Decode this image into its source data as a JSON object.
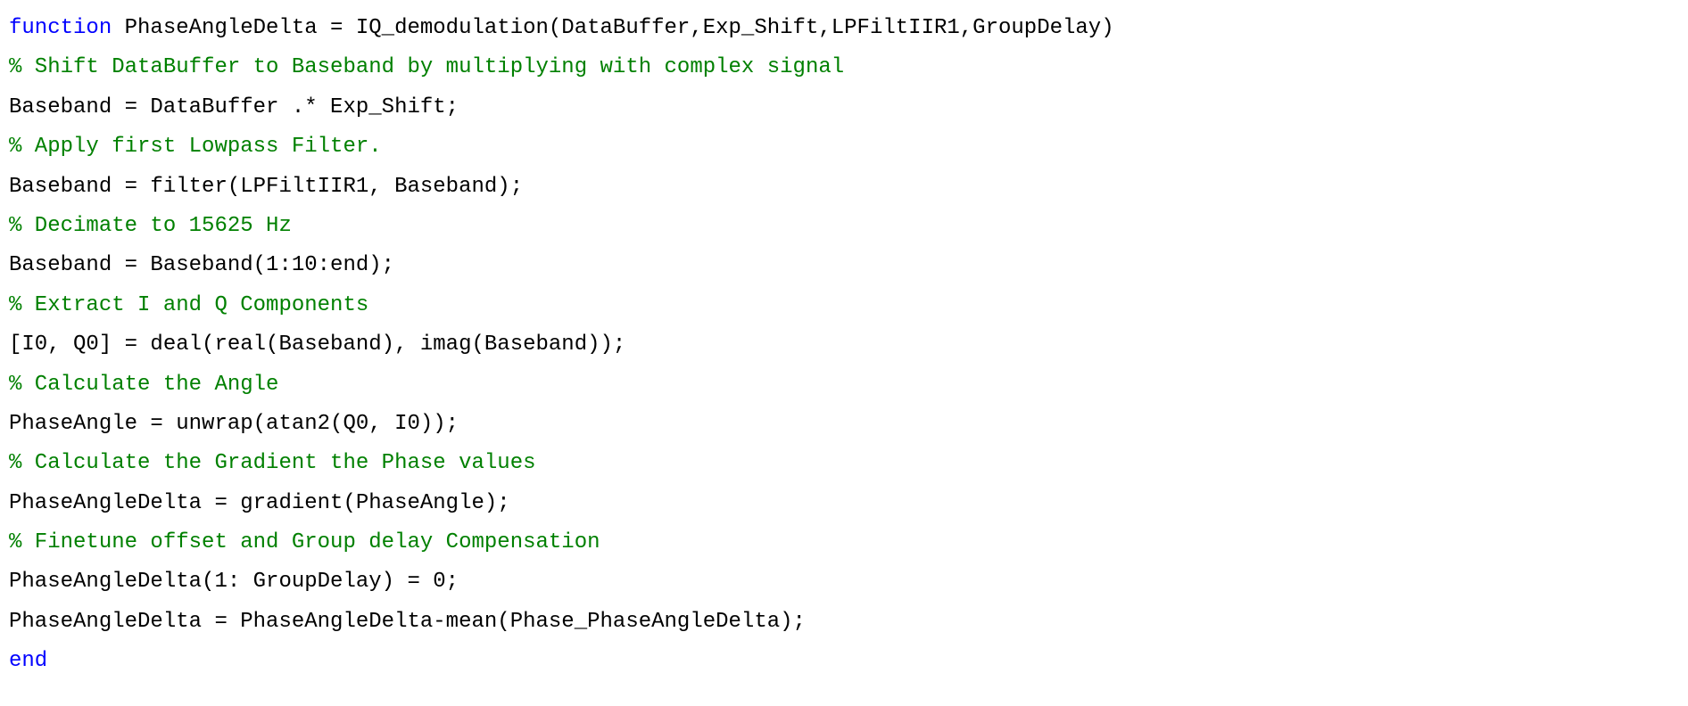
{
  "lines": [
    {
      "segments": [
        {
          "text": "function",
          "class": "keyword"
        },
        {
          "text": " PhaseAngleDelta = IQ_demodulation(DataBuffer,Exp_Shift,LPFiltIIR1,GroupDelay)",
          "class": "plain"
        }
      ]
    },
    {
      "segments": [
        {
          "text": "% Shift DataBuffer to Baseband by multiplying with complex signal",
          "class": "comment"
        }
      ]
    },
    {
      "segments": [
        {
          "text": "Baseband = DataBuffer .* Exp_Shift;",
          "class": "plain"
        }
      ]
    },
    {
      "segments": [
        {
          "text": "% Apply first Lowpass Filter.",
          "class": "comment"
        }
      ]
    },
    {
      "segments": [
        {
          "text": "Baseband = filter(LPFiltIIR1, Baseband);",
          "class": "plain"
        }
      ]
    },
    {
      "segments": [
        {
          "text": "% Decimate to 15625 Hz",
          "class": "comment"
        }
      ]
    },
    {
      "segments": [
        {
          "text": "Baseband = Baseband(1:10:end);",
          "class": "plain"
        }
      ]
    },
    {
      "segments": [
        {
          "text": "% Extract I and Q Components",
          "class": "comment"
        }
      ]
    },
    {
      "segments": [
        {
          "text": "[I0, Q0] = deal(real(Baseband), imag(Baseband));",
          "class": "plain"
        }
      ]
    },
    {
      "segments": [
        {
          "text": "% Calculate the Angle",
          "class": "comment"
        }
      ]
    },
    {
      "segments": [
        {
          "text": "PhaseAngle = unwrap(atan2(Q0, I0));",
          "class": "plain"
        }
      ]
    },
    {
      "segments": [
        {
          "text": "% Calculate the Gradient the Phase values",
          "class": "comment"
        }
      ]
    },
    {
      "segments": [
        {
          "text": "PhaseAngleDelta = gradient(PhaseAngle);",
          "class": "plain"
        }
      ]
    },
    {
      "segments": [
        {
          "text": "% Finetune offset and Group delay Compensation",
          "class": "comment"
        }
      ]
    },
    {
      "segments": [
        {
          "text": "PhaseAngleDelta(1: GroupDelay) = 0;",
          "class": "plain"
        }
      ]
    },
    {
      "segments": [
        {
          "text": "PhaseAngleDelta = PhaseAngleDelta-mean(Phase_PhaseAngleDelta);",
          "class": "plain"
        }
      ]
    },
    {
      "segments": [
        {
          "text": "end",
          "class": "keyword"
        }
      ]
    }
  ]
}
